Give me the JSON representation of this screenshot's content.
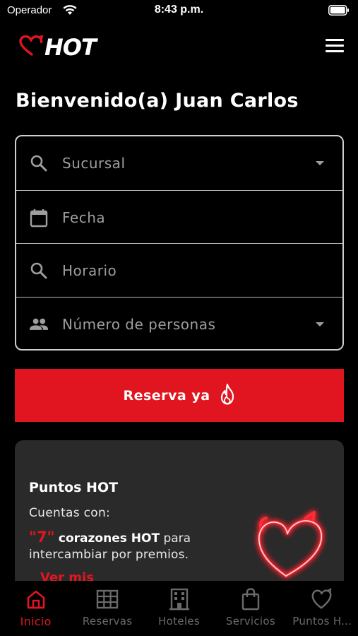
{
  "status_bar": {
    "carrier": "Operador",
    "time": "8:43 p.m."
  },
  "header": {
    "logo_text": "HOT",
    "menu_icon": "hamburger-menu-icon"
  },
  "welcome": "Bienvenido(a) Juan Carlos",
  "form": {
    "fields": [
      {
        "icon": "search-icon",
        "placeholder": "Sucursal",
        "dropdown": true
      },
      {
        "icon": "calendar-icon",
        "placeholder": "Fecha",
        "dropdown": false
      },
      {
        "icon": "search-icon",
        "placeholder": "Horario",
        "dropdown": false
      },
      {
        "icon": "people-icon",
        "placeholder": "Número de personas",
        "dropdown": true
      }
    ]
  },
  "reserve_button": {
    "label": "Reserva ya",
    "icon": "flame-icon"
  },
  "points": {
    "title": "Puntos HOT",
    "subtitle": "Cuentas con:",
    "count": "\"7\"",
    "bold_text": "corazones HOT",
    "after_bold": "para",
    "line2": "intercambiar por premios.",
    "link": "Ver mis"
  },
  "tabs": [
    {
      "label": "Inicio",
      "icon": "home-icon",
      "active": true
    },
    {
      "label": "Reservas",
      "icon": "grid-table-icon",
      "active": false
    },
    {
      "label": "Hoteles",
      "icon": "building-icon",
      "active": false
    },
    {
      "label": "Servicios",
      "icon": "shopping-bag-icon",
      "active": false
    },
    {
      "label": "Puntos H...",
      "icon": "heart-icon",
      "active": false
    }
  ],
  "colors": {
    "accent": "#e1151f",
    "background": "#000000",
    "card": "#2a2a2a",
    "muted": "#9e9e9e"
  }
}
